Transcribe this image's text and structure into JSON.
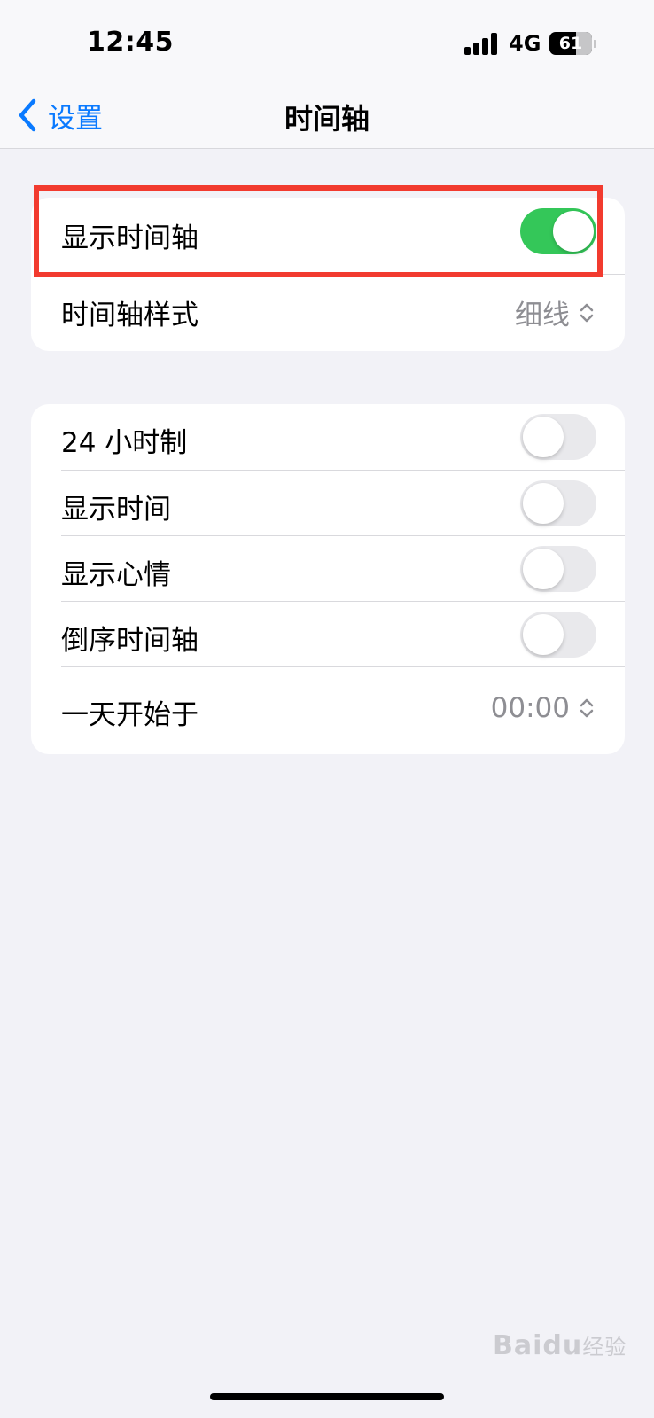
{
  "status_bar": {
    "time": "12:45",
    "network": "4G",
    "battery": "61"
  },
  "nav": {
    "back_label": "设置",
    "title": "时间轴"
  },
  "group1": {
    "show_timeline": {
      "label": "显示时间轴",
      "on": true
    },
    "timeline_style": {
      "label": "时间轴样式",
      "value": "细线"
    }
  },
  "group2": {
    "hour24": {
      "label": "24 小时制",
      "on": false
    },
    "show_time": {
      "label": "显示时间",
      "on": false
    },
    "show_mood": {
      "label": "显示心情",
      "on": false
    },
    "reverse_timeline": {
      "label": "倒序时间轴",
      "on": false
    },
    "day_starts_at": {
      "label": "一天开始于",
      "value": "00:00"
    }
  },
  "accent_colors": {
    "toggle_on": "#34c759",
    "link": "#0a7aff",
    "highlight": "#f23b2f"
  },
  "watermark": {
    "brand": "Baidu",
    "suffix": "经验"
  }
}
